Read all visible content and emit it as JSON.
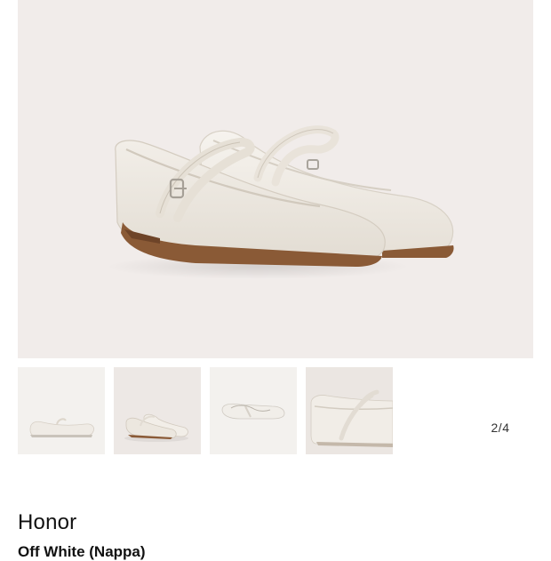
{
  "product": {
    "name": "Honor",
    "color_text": "Off White (Nappa)"
  },
  "gallery": {
    "counter": "2/4",
    "current_index": 2,
    "total": 4,
    "hero_alt": "Off white nappa Mary Jane ballet flats, pair view",
    "thumbnails": [
      {
        "label": "side view"
      },
      {
        "label": "pair view"
      },
      {
        "label": "top view"
      },
      {
        "label": "detail view"
      }
    ]
  },
  "colors": {
    "hero_bg": "#f1ecea",
    "leather": "#ece7df",
    "sole": "#8a5a36"
  }
}
